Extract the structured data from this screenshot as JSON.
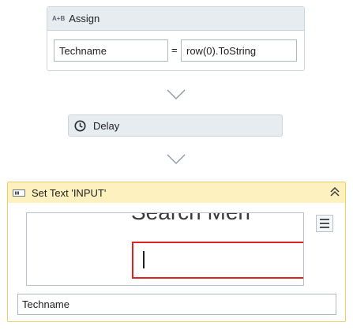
{
  "assign": {
    "title": "Assign",
    "icon_text": "A+B",
    "to_value": "Techname",
    "equals": "=",
    "value_expr": "row(0).ToString"
  },
  "delay": {
    "title": "Delay",
    "icon": "clock-icon"
  },
  "set_text": {
    "title": "Set Text 'INPUT'",
    "preview_text": "Search Men",
    "text_value": "Techname",
    "collapse_icon": "double-chevron-up-icon",
    "menu_icon": "hamburger-menu-icon"
  },
  "colors": {
    "header_bg": "#e7ecf1",
    "set_text_header_bg": "#fdf1c0",
    "highlight_red": "#e0231f"
  }
}
